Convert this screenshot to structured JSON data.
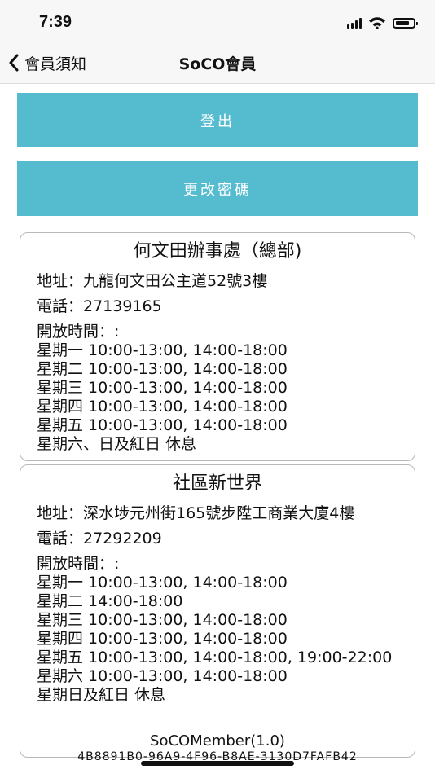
{
  "status": {
    "time": "7:39",
    "battery_level": 0.8
  },
  "nav": {
    "back_label": "會員須知",
    "title": "SoCO會員"
  },
  "buttons": {
    "logout": "登出",
    "change_password": "更改密碼"
  },
  "offices": [
    {
      "name": "何文田辦事處（總部)",
      "address": "地址：九龍何文田公主道52號3樓",
      "phone": "電話：27139165",
      "hours_label": "開放時間：:",
      "hours": [
        "星期一 10:00-13:00, 14:00-18:00",
        "星期二 10:00-13:00, 14:00-18:00",
        "星期三 10:00-13:00, 14:00-18:00",
        "星期四 10:00-13:00, 14:00-18:00",
        "星期五 10:00-13:00, 14:00-18:00",
        "星期六、日及紅日 休息"
      ]
    },
    {
      "name": "社區新世界",
      "address": "地址：深水埗元州街165號步陞工商業大廈4樓",
      "phone": "電話：27292209",
      "hours_label": "開放時間：:",
      "hours": [
        "星期一 10:00-13:00, 14:00-18:00",
        "星期二 14:00-18:00",
        "星期三 10:00-13:00, 14:00-18:00",
        "星期四 10:00-13:00, 14:00-18:00",
        "星期五 10:00-13:00, 14:00-18:00, 19:00-22:00",
        "星期六 10:00-13:00, 14:00-18:00",
        "星期日及紅日 休息"
      ]
    }
  ],
  "footer": {
    "app": "SoCOMember(1.0)",
    "device_id": "4B8891B0-96A9-4F96-B8AE-3130D7FAFB42"
  }
}
